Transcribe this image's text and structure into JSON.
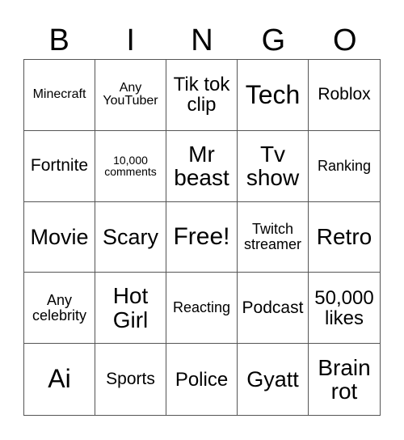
{
  "header": [
    "B",
    "I",
    "N",
    "G",
    "O"
  ],
  "cells": [
    "Minecraft",
    "Any\nYouTuber",
    "Tik tok\nclip",
    "Tech",
    "Roblox",
    "Fortnite",
    "10,000\ncomments",
    "Mr\nbeast",
    "Tv\nshow",
    "Ranking",
    "Movie",
    "Scary",
    "Free!",
    "Twitch\nstreamer",
    "Retro",
    "Any\ncelebrity",
    "Hot\nGirl",
    "Reacting",
    "Podcast",
    "50,000\nlikes",
    "Ai",
    "Sports",
    "Police",
    "Gyatt",
    "Brain\nrot"
  ]
}
